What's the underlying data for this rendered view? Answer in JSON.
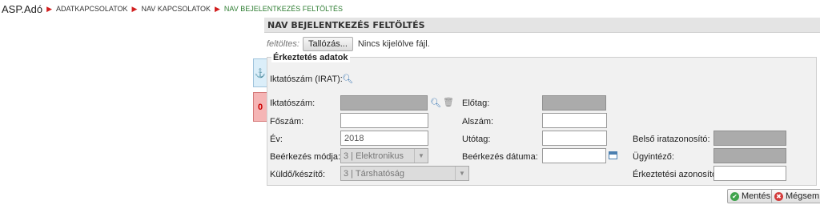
{
  "breadcrumb": {
    "app": "ASP.Adó",
    "items": [
      "ADATKAPCSOLATOK",
      "NAV KAPCSOLATOK",
      "NAV BEJELENTKEZÉS FELTÖLTÉS"
    ]
  },
  "header": {
    "title": "NAV BEJELENTKEZÉS FELTÖLTÉS"
  },
  "upload": {
    "label": "feltöltes:",
    "browse_label": "Tallózás...",
    "status": "Nincs kijelölve fájl."
  },
  "side_tabs": {
    "count": "0"
  },
  "form": {
    "legend": "Érkeztetés adatok",
    "iktatoszam_irat_label": "Iktatószám (IRAT):",
    "iktatoszam_label": "Iktatószám:",
    "iktatoszam_value": "",
    "elotag_label": "Előtag:",
    "foszam_label": "Főszám:",
    "alszam_label": "Alszám:",
    "ev_label": "Év:",
    "ev_value": "2018",
    "utotag_label": "Utótag:",
    "belso_label": "Belső iratazonosító:",
    "beerkezes_modja_label": "Beérkezés módja:",
    "beerkezes_modja_value": "3 | Elektronikus",
    "beerkezes_datuma_label": "Beérkezés dátuma:",
    "ugyintezo_label": "Ügyintéző:",
    "kuldo_label": "Küldő/készítő:",
    "kuldo_value": "3 | Társhatóság",
    "erkeztetesi_label": "Érkeztetési azonosító:"
  },
  "actions": {
    "save": "Mentés",
    "cancel": "Mégsem"
  },
  "colors": {
    "accent_green": "#2e7d32",
    "breadcrumb_arrow": "#d21f1f",
    "error_tab": "#f5b5b5"
  }
}
